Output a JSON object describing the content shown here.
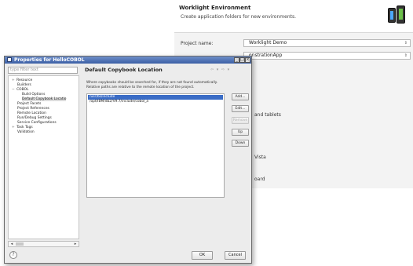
{
  "background_wizard": {
    "title": "Worklight Environment",
    "subtitle": "Create application folders for new environments.",
    "project_name_label": "Project name:",
    "project_name_value": "Worklight Demo",
    "app_combo_value": "onstrationApp",
    "fragments": [
      "and tablets",
      "Vista",
      "oard"
    ],
    "phone_icon_1": "iphone-icon",
    "phone_icon_2": "android-phone-icon"
  },
  "dialog": {
    "title": "Properties for HelloCOBOL",
    "filter_placeholder": "type filter text",
    "tree": [
      {
        "label": "Resource",
        "toggle": "+"
      },
      {
        "label": "Builders",
        "toggle": ""
      },
      {
        "label": "COBOL",
        "toggle": "−"
      },
      {
        "label": "Build Options",
        "toggle": ""
      },
      {
        "label": "Default Copybook Locatio",
        "toggle": ""
      },
      {
        "label": "Project Facets",
        "toggle": ""
      },
      {
        "label": "Project References",
        "toggle": ""
      },
      {
        "label": "Remote Location",
        "toggle": ""
      },
      {
        "label": "Run/Debug Settings",
        "toggle": ""
      },
      {
        "label": "Service Configurations",
        "toggle": ""
      },
      {
        "label": "Task Tags",
        "toggle": "+"
      },
      {
        "label": "Validation",
        "toggle": ""
      }
    ],
    "page_title": "Default Copybook Location",
    "description_line1": "Where copybooks should be searched for, if they are not found automatically.",
    "description_line2": "Relative paths are relative to the remote location of the project.",
    "paths": [
      "/usr/bs/include",
      "/opt/IBM/db2/V9.7/include/cobol_a"
    ],
    "buttons": {
      "add": "Add...",
      "edit": "Edit...",
      "remove": "Remove",
      "up": "Up",
      "down": "Down",
      "ok": "OK",
      "cancel": "Cancel"
    }
  }
}
